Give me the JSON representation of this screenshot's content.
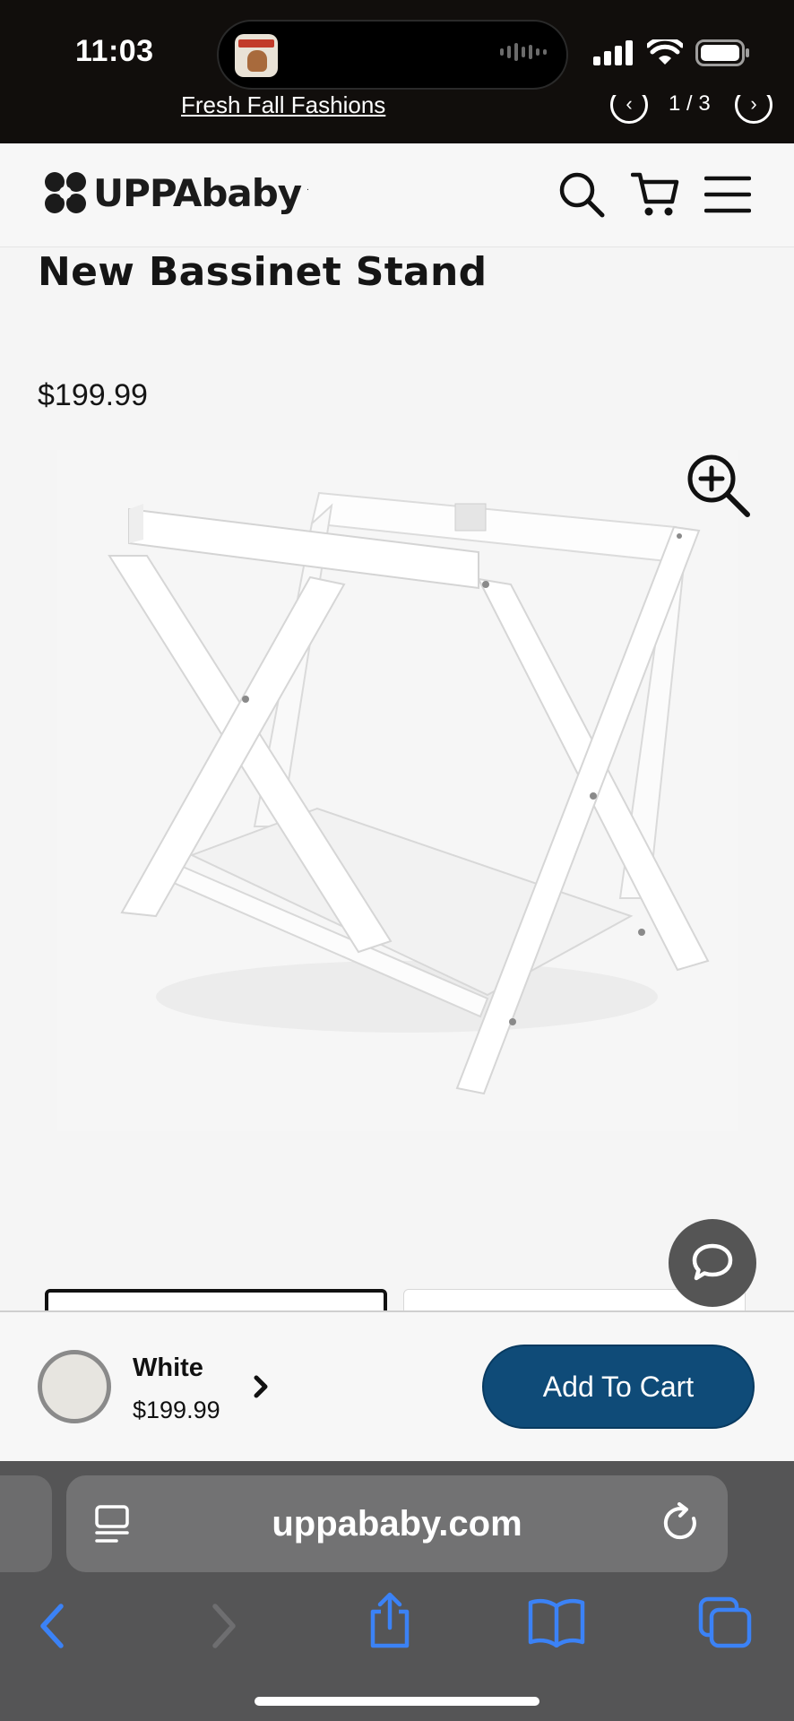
{
  "status_bar": {
    "time": "11:03"
  },
  "promo": {
    "text": "Fresh Fall Fashions",
    "counter": "1 / 3"
  },
  "header": {
    "logo_text": "UPPAbaby",
    "logo_tm": "."
  },
  "product": {
    "title": "New Bassinet Stand",
    "price": "$199.99"
  },
  "sticky_bar": {
    "color_name": "White",
    "color_price": "$199.99",
    "add_to_cart_label": "Add To Cart"
  },
  "browser": {
    "url": "uppababy.com"
  },
  "colors": {
    "accent": "#0f4b78",
    "status_bar_bg": "#110e0c",
    "safari_bg": "#555556",
    "safari_blue": "#3b82f6"
  }
}
